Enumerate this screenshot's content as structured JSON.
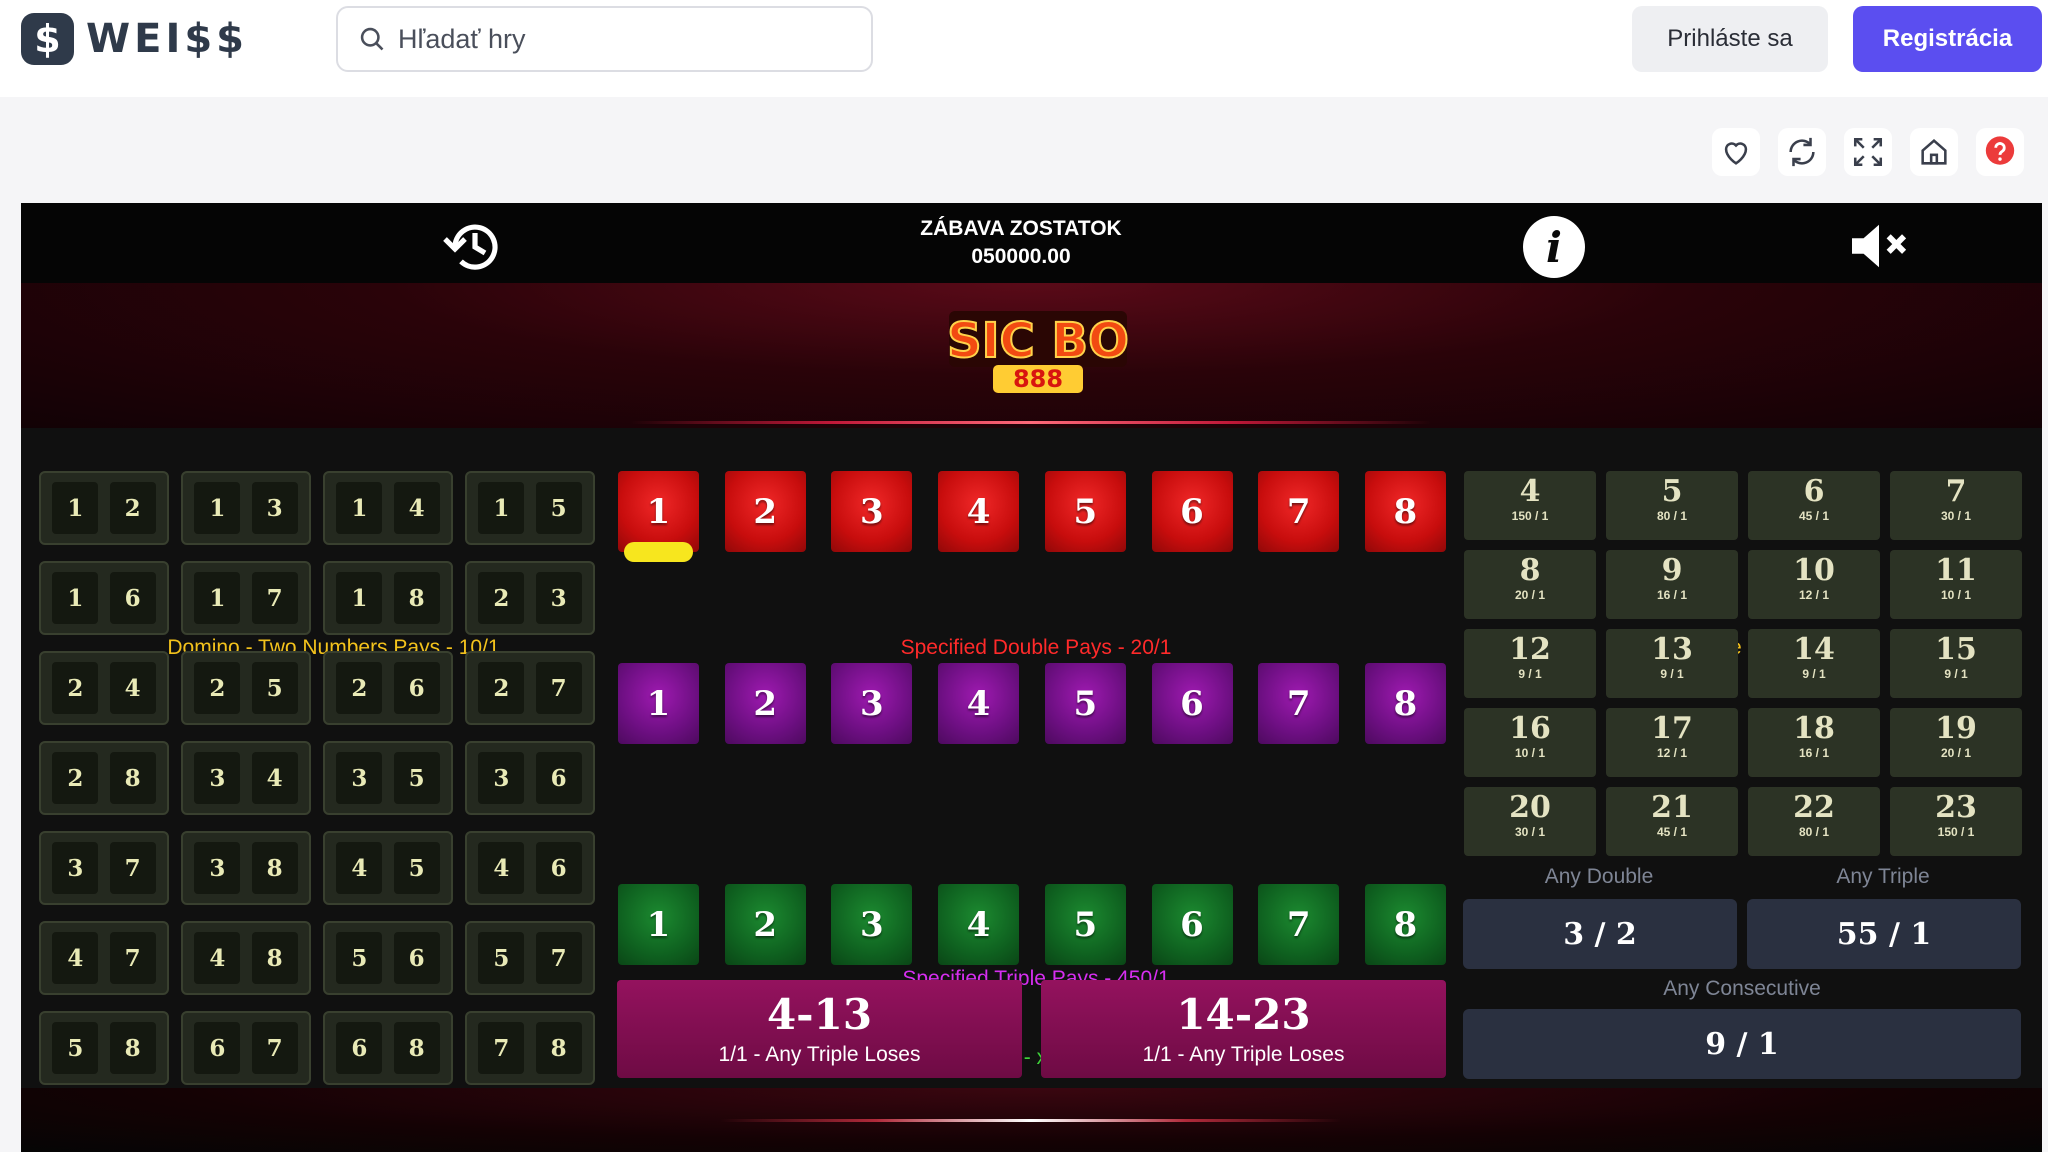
{
  "header": {
    "brand": "WEI$$",
    "brand_mark": "$",
    "search_placeholder": "Hľadať hry",
    "login_label": "Prihláste sa",
    "register_label": "Registrácia"
  },
  "tools": [
    "heart-icon",
    "refresh-icon",
    "fullscreen-icon",
    "home-icon",
    "help-icon"
  ],
  "game": {
    "balance_title": "ZÁBAVA ZOSTATOK",
    "balance_value": "050000.00",
    "logo_text": "SIC BO",
    "logo_sub": "888",
    "domino_title": "Domino - Two Numbers Pays - 10/1",
    "double_title": "Specified Double Pays - 20/1",
    "total_title": "Total Score of all 3 Dice",
    "triple_title": "Specified Triple Pays - 450/1",
    "single_title": "Single Number Pays - x1 3/2 - x2 4/1 - x3 7/1",
    "dominoes": [
      [
        "1",
        "2"
      ],
      [
        "1",
        "3"
      ],
      [
        "1",
        "4"
      ],
      [
        "1",
        "5"
      ],
      [
        "1",
        "6"
      ],
      [
        "1",
        "7"
      ],
      [
        "1",
        "8"
      ],
      [
        "2",
        "3"
      ],
      [
        "2",
        "4"
      ],
      [
        "2",
        "5"
      ],
      [
        "2",
        "6"
      ],
      [
        "2",
        "7"
      ],
      [
        "2",
        "8"
      ],
      [
        "3",
        "4"
      ],
      [
        "3",
        "5"
      ],
      [
        "3",
        "6"
      ],
      [
        "3",
        "7"
      ],
      [
        "3",
        "8"
      ],
      [
        "4",
        "5"
      ],
      [
        "4",
        "6"
      ],
      [
        "4",
        "7"
      ],
      [
        "4",
        "8"
      ],
      [
        "5",
        "6"
      ],
      [
        "5",
        "7"
      ],
      [
        "5",
        "8"
      ],
      [
        "6",
        "7"
      ],
      [
        "6",
        "8"
      ],
      [
        "7",
        "8"
      ]
    ],
    "numbers": [
      "1",
      "2",
      "3",
      "4",
      "5",
      "6",
      "7",
      "8"
    ],
    "totals": [
      {
        "n": "4",
        "p": "150 / 1"
      },
      {
        "n": "5",
        "p": "80 / 1"
      },
      {
        "n": "6",
        "p": "45 / 1"
      },
      {
        "n": "7",
        "p": "30 / 1"
      },
      {
        "n": "8",
        "p": "20 / 1"
      },
      {
        "n": "9",
        "p": "16 / 1"
      },
      {
        "n": "10",
        "p": "12 / 1"
      },
      {
        "n": "11",
        "p": "10 / 1"
      },
      {
        "n": "12",
        "p": "9 / 1"
      },
      {
        "n": "13",
        "p": "9 / 1"
      },
      {
        "n": "14",
        "p": "9 / 1"
      },
      {
        "n": "15",
        "p": "9 / 1"
      },
      {
        "n": "16",
        "p": "10 / 1"
      },
      {
        "n": "17",
        "p": "12 / 1"
      },
      {
        "n": "18",
        "p": "16 / 1"
      },
      {
        "n": "19",
        "p": "20 / 1"
      },
      {
        "n": "20",
        "p": "30 / 1"
      },
      {
        "n": "21",
        "p": "45 / 1"
      },
      {
        "n": "22",
        "p": "80 / 1"
      },
      {
        "n": "23",
        "p": "150 / 1"
      }
    ],
    "any_double_label": "Any Double",
    "any_double_value": "3 / 2",
    "any_triple_label": "Any Triple",
    "any_triple_value": "55 / 1",
    "any_consecutive_label": "Any Consecutive",
    "any_consecutive_value": "9 / 1",
    "range_low": {
      "title": "4-13",
      "sub": "1/1 - Any Triple Loses"
    },
    "range_high": {
      "title": "14-23",
      "sub": "1/1 - Any Triple Loses"
    }
  },
  "colors": {
    "accent": "#5b4ef0",
    "domino_title": "#f3c21c",
    "double_title": "#ff2a2a",
    "triple_title": "#d62ef0",
    "single_title": "#3fd23a",
    "total_title": "#f3c21c",
    "chip": "#f7e61e"
  }
}
